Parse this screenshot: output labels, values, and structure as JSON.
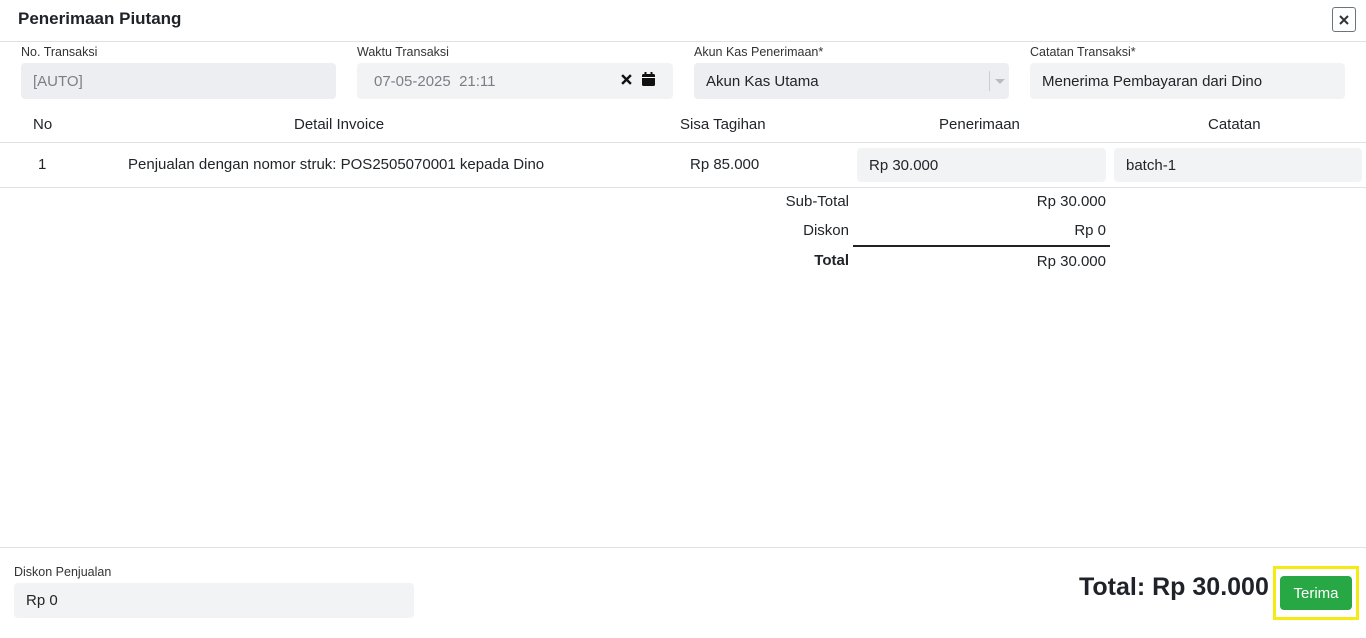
{
  "modal": {
    "title": "Penerimaan Piutang"
  },
  "form": {
    "no_transaksi": {
      "label": "No. Transaksi",
      "value": "[AUTO]"
    },
    "waktu_transaksi": {
      "label": "Waktu Transaksi",
      "value": "07-05-2025  21:11"
    },
    "akun_kas": {
      "label": "Akun Kas Penerimaan*",
      "value": "Akun Kas Utama"
    },
    "catatan_transaksi": {
      "label": "Catatan Transaksi*",
      "value": "Menerima Pembayaran dari Dino"
    }
  },
  "table": {
    "columns": [
      "No",
      "Detail Invoice",
      "Sisa Tagihan",
      "Penerimaan",
      "Catatan"
    ],
    "rows": [
      {
        "no": "1",
        "detail": "Penjualan dengan nomor struk: POS2505070001 kepada Dino",
        "sisa": "Rp 85.000",
        "penerimaan": "Rp 30.000",
        "catatan": "batch-1"
      }
    ]
  },
  "summary": {
    "subtotal_label": "Sub-Total",
    "subtotal_value": "Rp 30.000",
    "diskon_label": "Diskon",
    "diskon_value": "Rp 0",
    "total_label": "Total",
    "total_value": "Rp 30.000"
  },
  "footer": {
    "diskon_penjualan_label": "Diskon Penjualan",
    "diskon_penjualan_value": "Rp 0",
    "grand_total": "Total: Rp 30.000",
    "submit_label": "Terima"
  },
  "colors": {
    "primary_button": "#28a745",
    "highlight": "#f5ea14"
  },
  "icons": {
    "close": "close-icon",
    "clear": "clear-icon",
    "calendar": "calendar-icon",
    "dropdown": "chevron-down-icon"
  }
}
